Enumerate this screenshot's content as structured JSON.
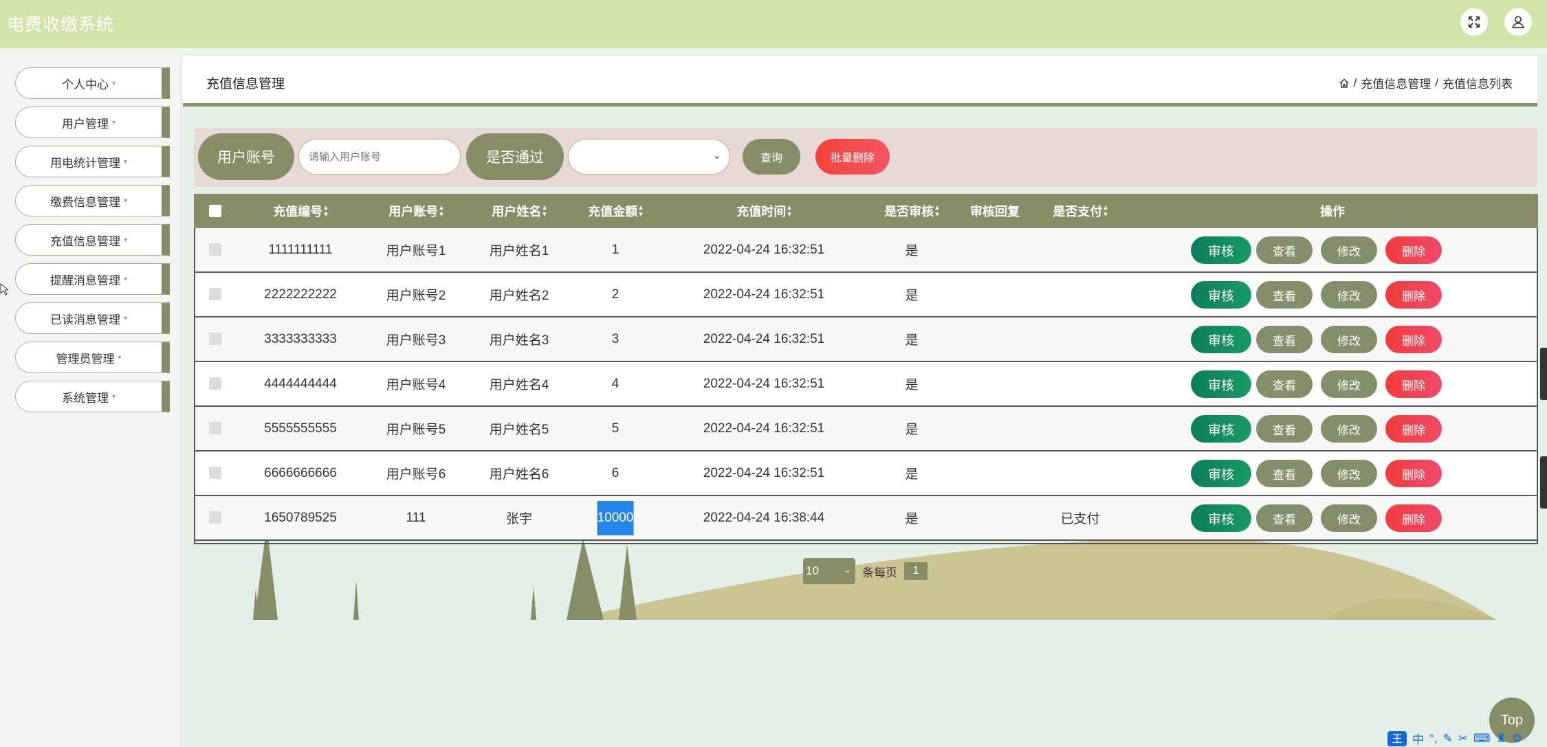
{
  "header": {
    "app_title": "电费收缴系统",
    "fullscreen_icon": "expand-icon",
    "user_icon": "user-icon"
  },
  "sidebar": {
    "items": [
      {
        "label": "个人中心"
      },
      {
        "label": "用户管理"
      },
      {
        "label": "用电统计管理"
      },
      {
        "label": "缴费信息管理"
      },
      {
        "label": "充值信息管理"
      },
      {
        "label": "提醒消息管理"
      },
      {
        "label": "已读消息管理"
      },
      {
        "label": "管理员管理"
      },
      {
        "label": "系统管理"
      }
    ],
    "caret": "▾"
  },
  "page": {
    "title": "充值信息管理",
    "breadcrumb": [
      "充值信息管理",
      "充值信息列表"
    ],
    "breadcrumb_sep": "/"
  },
  "search": {
    "account_label": "用户账号",
    "account_placeholder": "请输入用户账号",
    "approved_label": "是否通过",
    "approved_value": "",
    "query_button": "查询",
    "bulk_delete_button": "批量删除"
  },
  "table": {
    "columns": [
      "充值编号",
      "用户账号",
      "用户姓名",
      "充值金额",
      "充值时间",
      "是否审核",
      "审核回复",
      "是否支付",
      "操作"
    ],
    "rows": [
      {
        "id": "1111111111",
        "account": "用户账号1",
        "name": "用户姓名1",
        "amount": "1",
        "time": "2022-04-24 16:32:51",
        "audited": "是",
        "reply": "",
        "paid": ""
      },
      {
        "id": "2222222222",
        "account": "用户账号2",
        "name": "用户姓名2",
        "amount": "2",
        "time": "2022-04-24 16:32:51",
        "audited": "是",
        "reply": "",
        "paid": ""
      },
      {
        "id": "3333333333",
        "account": "用户账号3",
        "name": "用户姓名3",
        "amount": "3",
        "time": "2022-04-24 16:32:51",
        "audited": "是",
        "reply": "",
        "paid": ""
      },
      {
        "id": "4444444444",
        "account": "用户账号4",
        "name": "用户姓名4",
        "amount": "4",
        "time": "2022-04-24 16:32:51",
        "audited": "是",
        "reply": "",
        "paid": ""
      },
      {
        "id": "5555555555",
        "account": "用户账号5",
        "name": "用户姓名5",
        "amount": "5",
        "time": "2022-04-24 16:32:51",
        "audited": "是",
        "reply": "",
        "paid": ""
      },
      {
        "id": "6666666666",
        "account": "用户账号6",
        "name": "用户姓名6",
        "amount": "6",
        "time": "2022-04-24 16:32:51",
        "audited": "是",
        "reply": "",
        "paid": ""
      },
      {
        "id": "1650789525",
        "account": "111",
        "name": "张宇",
        "amount": "10000",
        "time": "2022-04-24 16:38:44",
        "audited": "是",
        "reply": "",
        "paid": "已支付"
      }
    ],
    "actions": {
      "audit": "审核",
      "view": "查看",
      "edit": "修改",
      "delete": "删除"
    },
    "highlighted_cell": {
      "row": 6,
      "column": "amount"
    }
  },
  "pagination": {
    "page_size": "10",
    "per_page_label": "条每页",
    "current_page": "1"
  },
  "back_to_top": "Top",
  "ime": {
    "logo": "王",
    "mode": "中"
  },
  "colors": {
    "header_bg": "#d3e2a8",
    "accent": "#868d67",
    "danger": "#f2433b",
    "audit_green": "#0b7d5a",
    "selection": "#2683e8"
  }
}
